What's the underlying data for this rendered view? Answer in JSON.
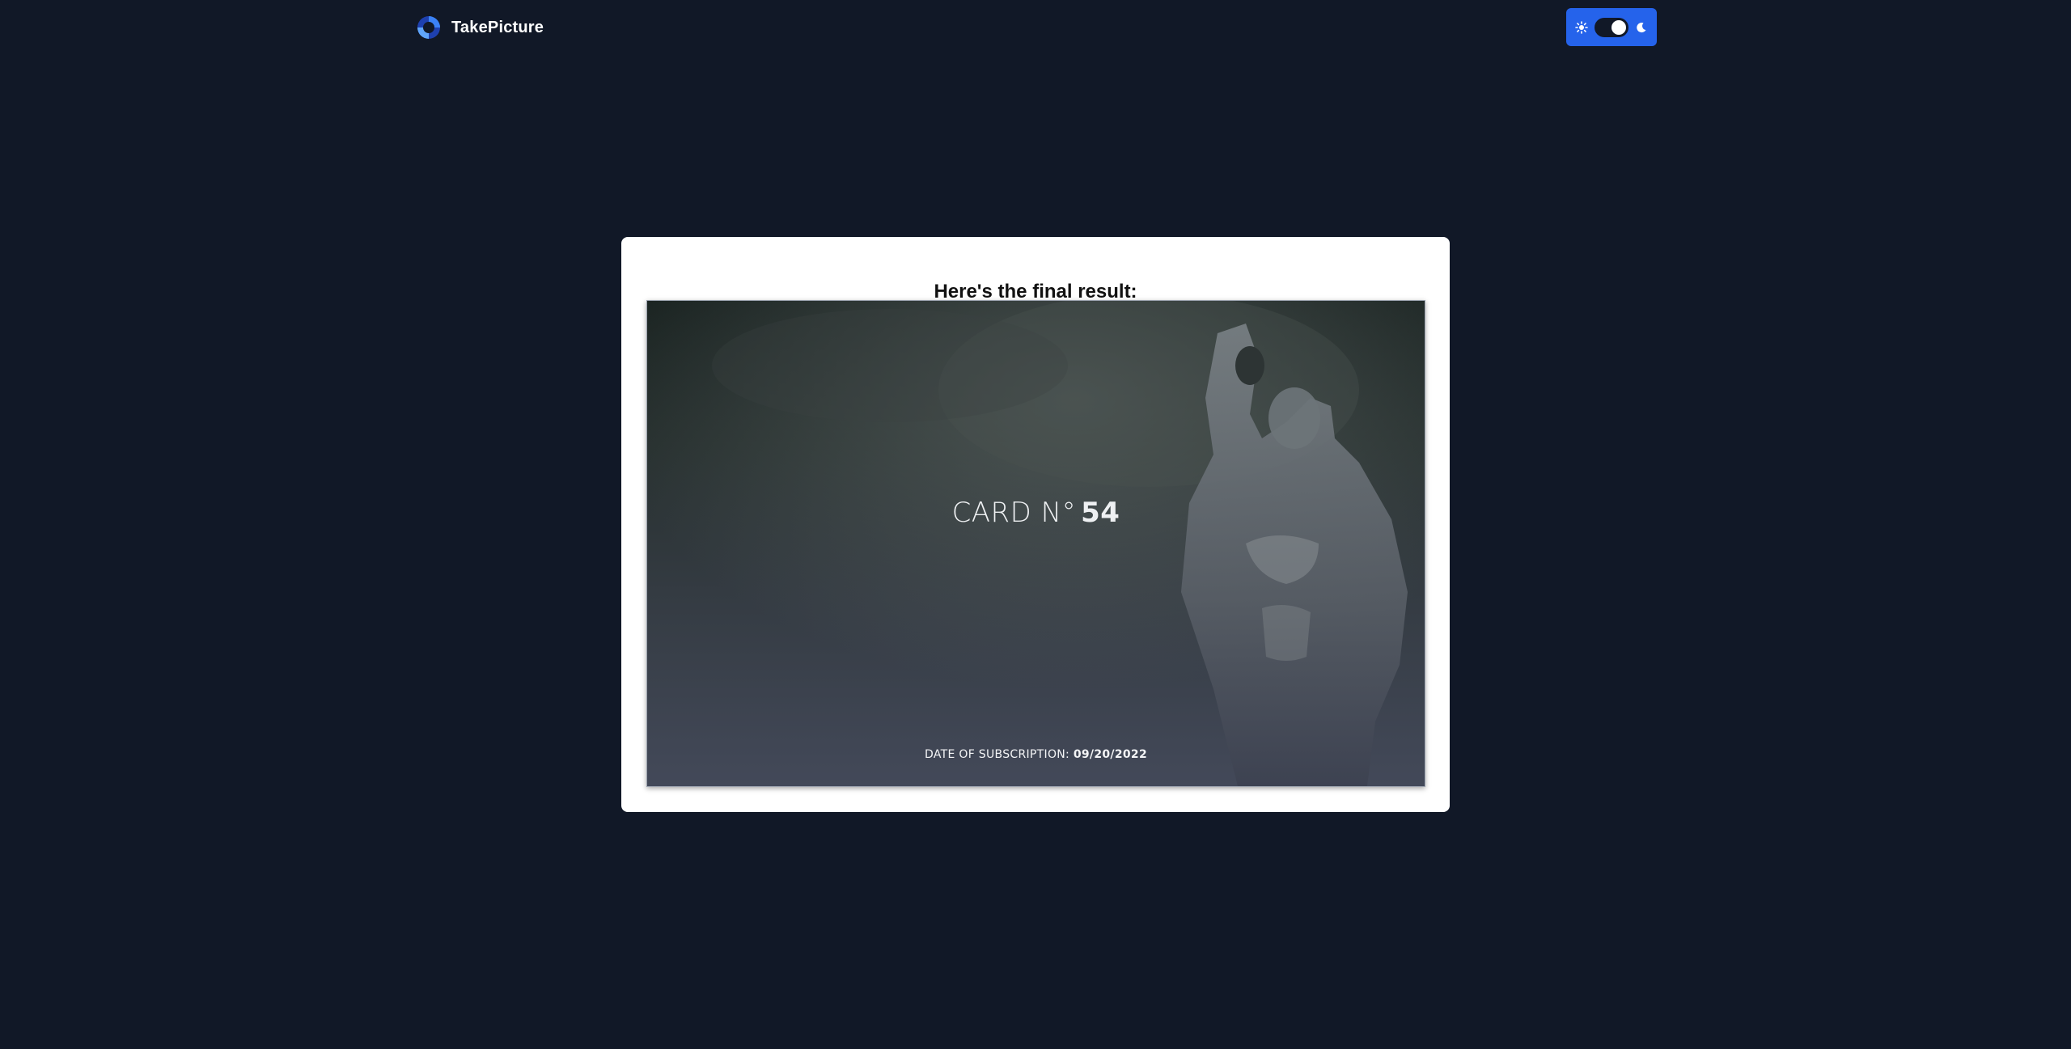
{
  "navbar": {
    "brand_name": "TakePicture",
    "logo_icon": "circle-logo-icon",
    "theme_toggle": {
      "sun_icon": "sun-icon",
      "moon_icon": "moon-icon",
      "mode": "dark"
    }
  },
  "result": {
    "title": "Here's the final result:",
    "card": {
      "number_prefix": "CARD N°",
      "number_value": "54",
      "subscription_label": "DATE OF SUBSCRIPTION:",
      "subscription_date": "09/20/2022"
    }
  },
  "colors": {
    "page_background": "#111827",
    "toggle_accent": "#2563eb",
    "panel_background": "#ffffff"
  }
}
